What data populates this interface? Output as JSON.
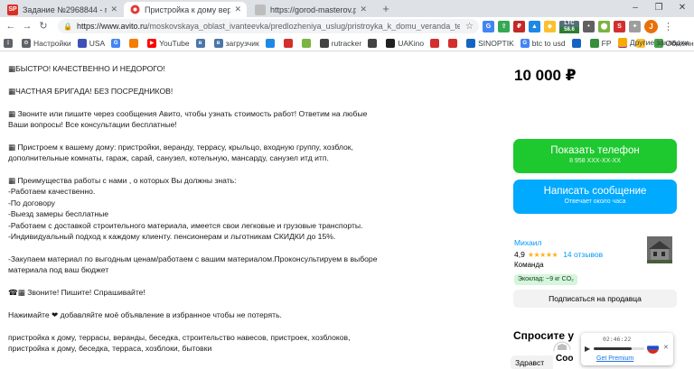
{
  "browser": {
    "tabs": [
      {
        "favicon_text": "SP",
        "favicon_color": "#d93025",
        "title": "Задание №2968844 - просмотр з"
      },
      {
        "favicon_text": "●",
        "favicon_color": "#e53935",
        "title": "Пристройка к дому веранда терр"
      },
      {
        "favicon_text": "●",
        "favicon_color": "#9e9e9e",
        "title": "https://gorod-masterov.pro/m"
      }
    ],
    "new_tab_label": "+",
    "window_controls": [
      "–",
      "❐",
      "✕"
    ],
    "nav": {
      "back": "←",
      "forward": "→",
      "reload": "↻"
    },
    "url_domain": "https://www.avito.ru",
    "url_path": "/moskovskaya_oblast_ivanteevka/predlozheniya_uslug/pristroyka_k_domu_veranda_terrasa_pod_klyuch_81...",
    "extensions": [
      {
        "text": "G",
        "color": "#4285f4"
      },
      {
        "text": "⇪",
        "color": "#34a853"
      },
      {
        "text": "₽",
        "color": "#c62828"
      },
      {
        "text": "▲",
        "color": "#1e88e5"
      },
      {
        "text": "◆",
        "color": "#fbc02d"
      },
      {
        "text": "LTC",
        "color": "#546e7a"
      },
      {
        "text": "•",
        "color": "#616161"
      },
      {
        "text": "⬤",
        "color": "#7cb342"
      },
      {
        "text": "S",
        "color": "#d32f2f"
      }
    ],
    "ltc_value": "58.6",
    "ltc_badge_label": "BUG",
    "ltc_badge_color": "#2e7d32",
    "profile_initial": "J",
    "menu_icon": "⋮"
  },
  "bookmarks": [
    {
      "label": "Настройки",
      "color": "#5f6368"
    },
    {
      "label": "USA",
      "color": "#3f51b5"
    },
    {
      "label": "G",
      "color": "#4285f4"
    },
    {
      "label": "",
      "color": "#f57c00"
    },
    {
      "label": "YouTube",
      "color": "#ff0000"
    },
    {
      "label": "",
      "color": "#4a76a8"
    },
    {
      "label": "загрузчик",
      "color": "#4a76a8"
    },
    {
      "label": "",
      "color": "#1e88e5"
    },
    {
      "label": "",
      "color": "#d32f2f"
    },
    {
      "label": "",
      "color": "#7cb342"
    },
    {
      "label": "rutracker",
      "color": "#424242"
    },
    {
      "label": "",
      "color": "#424242"
    },
    {
      "label": "UAKino",
      "color": "#212121"
    },
    {
      "label": "",
      "color": "#d32f2f"
    },
    {
      "label": "",
      "color": "#d32f2f"
    },
    {
      "label": "SINOPTIK",
      "color": "#1565c0"
    },
    {
      "label": "btc to usd",
      "color": "#4285f4"
    },
    {
      "label": "",
      "color": "#1565c0"
    },
    {
      "label": "FP",
      "color": "#388e3c"
    },
    {
      "label": "",
      "color": "#8e24aa"
    },
    {
      "label": "",
      "color": "#fbc02d"
    },
    {
      "label": "Обменник",
      "color": "#43a047"
    },
    {
      "label": "maps",
      "color": "#34a853"
    }
  ],
  "bookmarks_other": "Другие закладки",
  "listing": {
    "description": [
      "▦БЫСТРО! КАЧЕСТВЕННО И НЕДОРОГО!",
      "▦ЧАСТНАЯ БРИГАДА! БЕЗ ПОСРЕДНИКОВ!",
      "▦ Звоните или пишите через сообщения Авито, чтобы узнать стоимость работ! Ответим на любые Ваши вопросы! Все консультации бесплатные!",
      "▦ Пристроем к вашему дому: пристройки, веранду, террасу, крыльцо, входную группу, хозблок, дополнительные комнаты, гараж, сарай, санузел, котельную, мансарду, санузел итд итп.",
      "▦ Преимущества работы с нами , о которых Вы должны знать:\n-Работаем качественно.\n-По договору\n-Выезд замеры бесплатные\n-Работаем с доставкой строительного материала, имеется свои легковые и грузовые транспорты.\n-Индивидуальный подход к каждому клиенту. пенсионерам и льготникам СКИДКИ до 15%.",
      "-Закупаем материал по выгодным ценам/работаем с вашим материалом.Проконсультируем в выборе материала под ваш бюджет",
      "☎▦ Звоните! Пишите! Спрашивайте!",
      "Нажимайте ❤ добавляйте моё объявление в избранное чтобы не потерять.",
      "пристройка к дому, террасы, веранды, беседка, строительство навесов, пристроек, хозблоков,\nпристройка к дому, беседка, терраса, хозблоки, бытовки"
    ],
    "price": "10 000 ₽",
    "phone_button": "Показать телефон",
    "phone_number": "8 958 XXX-XX-XX",
    "message_button": "Написать сообщение",
    "message_sub": "Отвечает около часа",
    "seller_name": "Михаил",
    "seller_rating": "4,9",
    "seller_stars": "★★★★★",
    "seller_reviews": "14 отзывов",
    "seller_type": "Команда",
    "eco_badge": "Экоклад: ~9 кг CO₂",
    "subscribe_button": "Подписаться на продавца",
    "ask_title": "Спросите у",
    "ask_chip": "Здравст"
  },
  "vpn_popup": {
    "timer": "02:46:22",
    "progress": 0.75,
    "premium_link": "Get Premium",
    "close": "✕",
    "chat_peek": "Соо"
  },
  "colors": {
    "avito_green": "#1ec82f",
    "avito_blue": "#00aaff",
    "link_blue": "#0099f7"
  }
}
